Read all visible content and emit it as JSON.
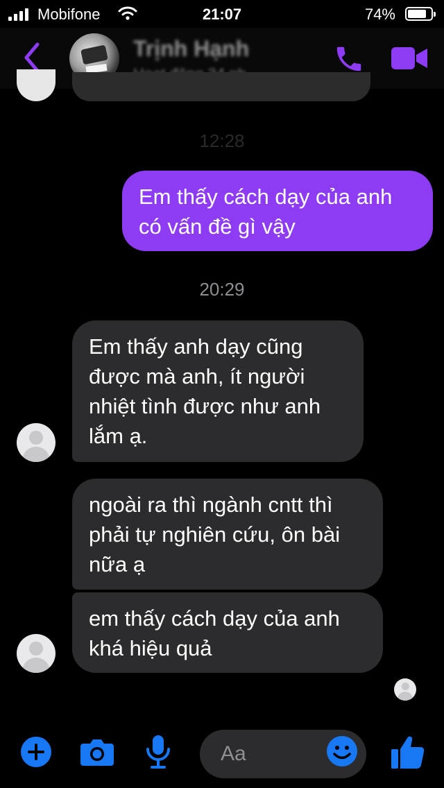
{
  "status_bar": {
    "carrier": "Mobifone",
    "time": "21:07",
    "battery": "74%"
  },
  "header": {
    "contact_name": "Trịnh Hạnh",
    "contact_status": "Hoạt động 34 ph...",
    "accent_color": "#8e3cf4",
    "icons": [
      "back-icon",
      "phone-icon",
      "video-camera-icon"
    ]
  },
  "conversation": {
    "faint_timestamp": "12:28",
    "timestamp": "20:29",
    "sent": {
      "line1": "Em thấy cách dạy của anh",
      "line2": "có vấn đề gì vậy"
    },
    "received": [
      {
        "line1": "Em thấy anh dạy cũng",
        "line2": "được mà anh, ít người",
        "line3": "nhiệt tình được như anh",
        "line4": "lắm ạ."
      },
      {
        "line1": "ngoài ra thì ngành cntt thì",
        "line2": "phải tự nghiên cứu, ôn bài",
        "line3": "nữa ạ"
      },
      {
        "line1": "em thấy cách dạy của anh",
        "line2": "khá hiệu quả"
      }
    ],
    "colors": {
      "sent_bubble": "#8e3cf4",
      "received_bubble": "#2c2c2e"
    }
  },
  "composer": {
    "placeholder": "Aa",
    "accent_color": "#1877f2",
    "icons": [
      "plus-icon",
      "camera-icon",
      "microphone-icon",
      "emoji-icon",
      "thumbs-up-icon"
    ]
  }
}
